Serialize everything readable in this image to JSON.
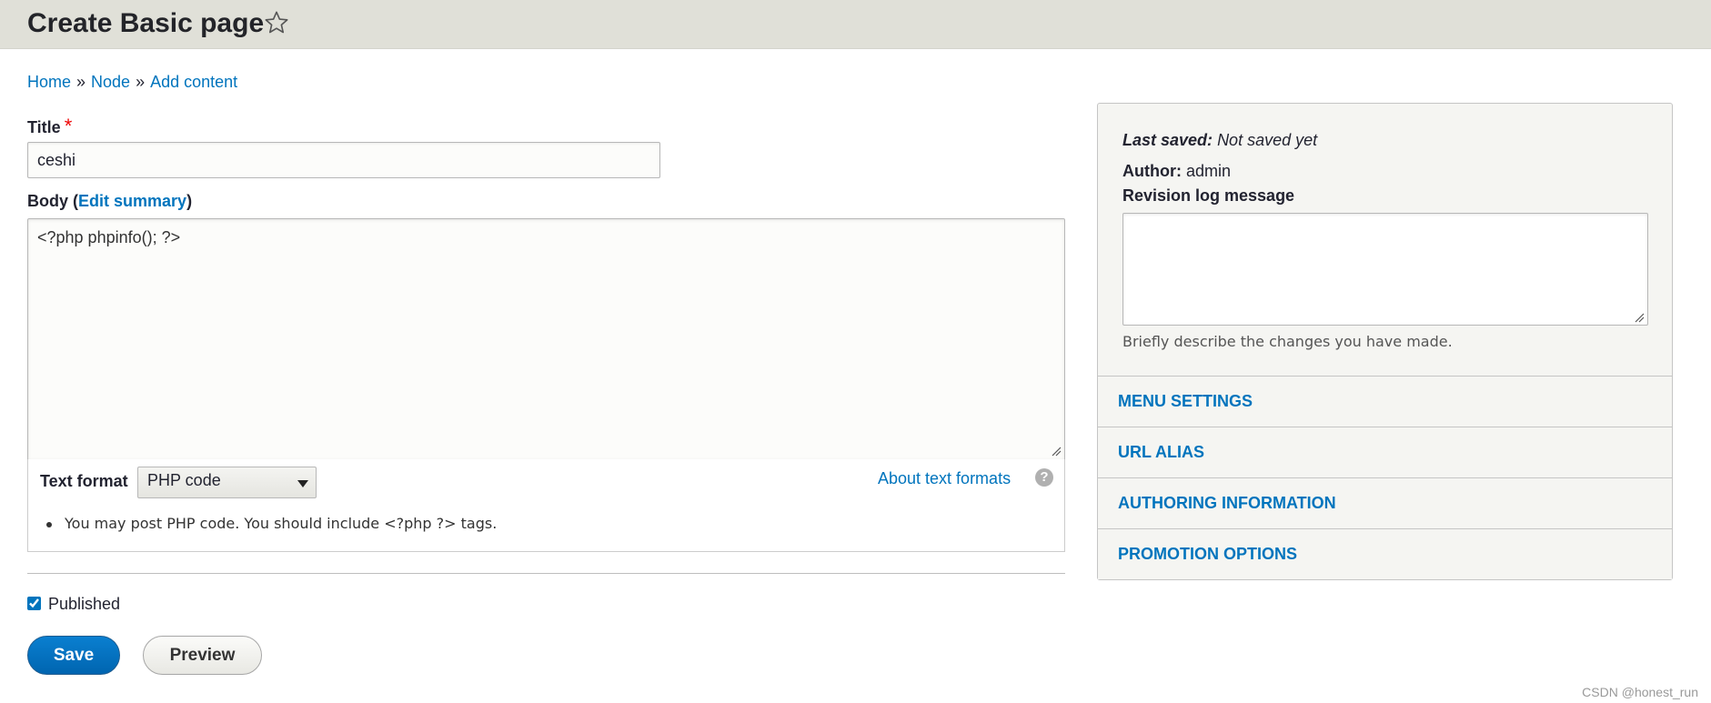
{
  "header": {
    "title": "Create Basic page",
    "star_icon": "star-icon"
  },
  "breadcrumb": {
    "items": [
      "Home",
      "Node",
      "Add content"
    ],
    "separator": "»"
  },
  "form": {
    "title_label": "Title",
    "title_required": "*",
    "title_value": "ceshi",
    "body_label": "Body",
    "body_open_paren": "(",
    "body_edit_summary": "Edit summary",
    "body_close_paren": ")",
    "body_value": "<?php phpinfo(); ?>",
    "text_format_label": "Text format",
    "text_format_value": "PHP code",
    "about_formats_link": "About text formats",
    "help_icon_text": "?",
    "format_tip": "You may post PHP code. You should include <?php ?> tags.",
    "published_label": "Published",
    "published_checked": true,
    "save_label": "Save",
    "preview_label": "Preview"
  },
  "sidebar": {
    "last_saved_label": "Last saved:",
    "last_saved_value": "Not saved yet",
    "author_label": "Author:",
    "author_value": "admin",
    "revision_label": "Revision log message",
    "revision_description": "Briefly describe the changes you have made.",
    "sections": [
      "MENU SETTINGS",
      "URL ALIAS",
      "AUTHORING INFORMATION",
      "PROMOTION OPTIONS"
    ]
  },
  "watermark": "CSDN @honest_run",
  "colors": {
    "link": "#0074bd",
    "header_bg": "#e0e0d8",
    "primary_button": "#0071b8",
    "required": "#ee0000"
  }
}
